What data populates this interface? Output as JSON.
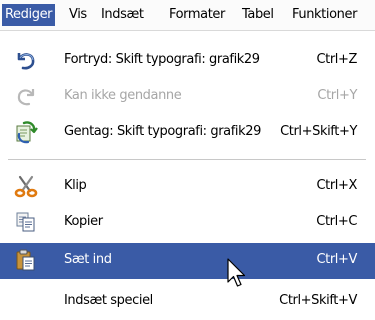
{
  "menubar": {
    "items": [
      {
        "label": "Rediger"
      },
      {
        "label": "Vis"
      },
      {
        "label": "Indsæt"
      },
      {
        "label": "Formater"
      },
      {
        "label": "Tabel"
      },
      {
        "label": "Funktioner"
      }
    ]
  },
  "menu": {
    "items": [
      {
        "label": "Fortryd: Skift typografi: grafik29",
        "shortcut": "Ctrl+Z",
        "icon": "undo-icon"
      },
      {
        "label": "Kan ikke gendanne",
        "shortcut": "Ctrl+Y",
        "icon": "redo-icon",
        "disabled": true
      },
      {
        "label": "Gentag: Skift typografi: grafik29",
        "shortcut": "Ctrl+Skift+Y",
        "icon": "repeat-icon"
      },
      {
        "label": "Klip",
        "shortcut": "Ctrl+X",
        "icon": "scissors-icon"
      },
      {
        "label": "Kopier",
        "shortcut": "Ctrl+C",
        "icon": "copy-icon"
      },
      {
        "label": "Sæt ind",
        "shortcut": "Ctrl+V",
        "icon": "paste-icon",
        "highlighted": true
      },
      {
        "label": "Indsæt speciel",
        "shortcut": "Ctrl+Skift+V"
      }
    ]
  },
  "colors": {
    "highlight": "#3a5ba6",
    "disabled_text": "#a6a6a6"
  }
}
